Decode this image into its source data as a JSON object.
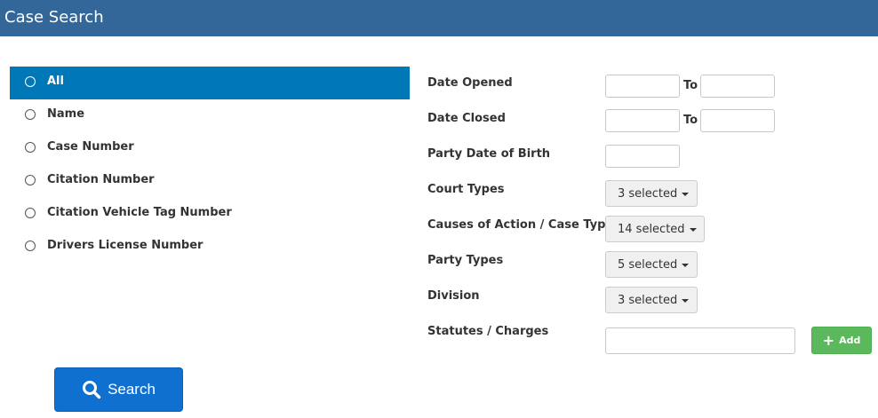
{
  "header": {
    "title": "Case Search"
  },
  "search_options": [
    {
      "label": "All",
      "selected": true
    },
    {
      "label": "Name",
      "selected": false
    },
    {
      "label": "Case Number",
      "selected": false
    },
    {
      "label": "Citation Number",
      "selected": false
    },
    {
      "label": "Citation Vehicle Tag Number",
      "selected": false
    },
    {
      "label": "Drivers License Number",
      "selected": false
    }
  ],
  "search_button": {
    "label": "Search"
  },
  "filters": {
    "date_opened": {
      "label": "Date Opened",
      "from_value": "",
      "to_label": "To",
      "to_value": ""
    },
    "date_closed": {
      "label": "Date Closed",
      "from_value": "",
      "to_label": "To",
      "to_value": ""
    },
    "party_dob": {
      "label": "Party Date of Birth",
      "value": ""
    },
    "court_types": {
      "label": "Court Types",
      "selected_text": "3 selected"
    },
    "causes_of_action": {
      "label": "Causes of Action / Case Types",
      "selected_text": "14 selected"
    },
    "party_types": {
      "label": "Party Types",
      "selected_text": "5 selected"
    },
    "division": {
      "label": "Division",
      "selected_text": "3 selected"
    },
    "statutes": {
      "label": "Statutes / Charges",
      "value": "",
      "add_label": "Add"
    }
  },
  "colors": {
    "header": "#336699",
    "selected_option": "#0077b6",
    "search_button": "#1070cf",
    "add_button": "#5cb85c"
  }
}
